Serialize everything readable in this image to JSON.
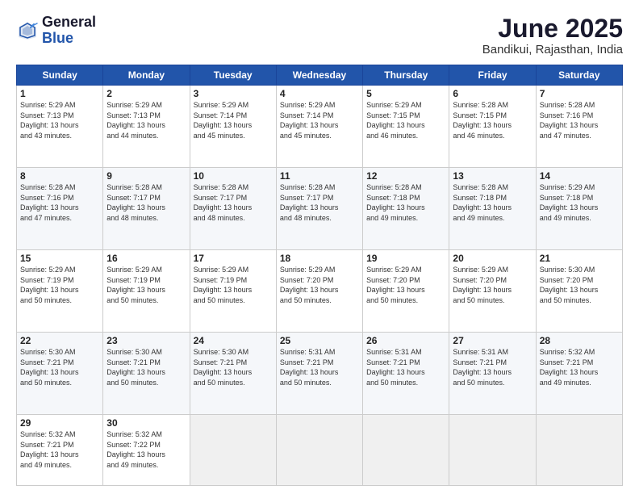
{
  "logo": {
    "general": "General",
    "blue": "Blue"
  },
  "title": "June 2025",
  "location": "Bandikui, Rajasthan, India",
  "headers": [
    "Sunday",
    "Monday",
    "Tuesday",
    "Wednesday",
    "Thursday",
    "Friday",
    "Saturday"
  ],
  "rows": [
    [
      {
        "day": "1",
        "text": "Sunrise: 5:29 AM\nSunset: 7:13 PM\nDaylight: 13 hours\nand 43 minutes."
      },
      {
        "day": "2",
        "text": "Sunrise: 5:29 AM\nSunset: 7:13 PM\nDaylight: 13 hours\nand 44 minutes."
      },
      {
        "day": "3",
        "text": "Sunrise: 5:29 AM\nSunset: 7:14 PM\nDaylight: 13 hours\nand 45 minutes."
      },
      {
        "day": "4",
        "text": "Sunrise: 5:29 AM\nSunset: 7:14 PM\nDaylight: 13 hours\nand 45 minutes."
      },
      {
        "day": "5",
        "text": "Sunrise: 5:29 AM\nSunset: 7:15 PM\nDaylight: 13 hours\nand 46 minutes."
      },
      {
        "day": "6",
        "text": "Sunrise: 5:28 AM\nSunset: 7:15 PM\nDaylight: 13 hours\nand 46 minutes."
      },
      {
        "day": "7",
        "text": "Sunrise: 5:28 AM\nSunset: 7:16 PM\nDaylight: 13 hours\nand 47 minutes."
      }
    ],
    [
      {
        "day": "8",
        "text": "Sunrise: 5:28 AM\nSunset: 7:16 PM\nDaylight: 13 hours\nand 47 minutes."
      },
      {
        "day": "9",
        "text": "Sunrise: 5:28 AM\nSunset: 7:17 PM\nDaylight: 13 hours\nand 48 minutes."
      },
      {
        "day": "10",
        "text": "Sunrise: 5:28 AM\nSunset: 7:17 PM\nDaylight: 13 hours\nand 48 minutes."
      },
      {
        "day": "11",
        "text": "Sunrise: 5:28 AM\nSunset: 7:17 PM\nDaylight: 13 hours\nand 48 minutes."
      },
      {
        "day": "12",
        "text": "Sunrise: 5:28 AM\nSunset: 7:18 PM\nDaylight: 13 hours\nand 49 minutes."
      },
      {
        "day": "13",
        "text": "Sunrise: 5:28 AM\nSunset: 7:18 PM\nDaylight: 13 hours\nand 49 minutes."
      },
      {
        "day": "14",
        "text": "Sunrise: 5:29 AM\nSunset: 7:18 PM\nDaylight: 13 hours\nand 49 minutes."
      }
    ],
    [
      {
        "day": "15",
        "text": "Sunrise: 5:29 AM\nSunset: 7:19 PM\nDaylight: 13 hours\nand 50 minutes."
      },
      {
        "day": "16",
        "text": "Sunrise: 5:29 AM\nSunset: 7:19 PM\nDaylight: 13 hours\nand 50 minutes."
      },
      {
        "day": "17",
        "text": "Sunrise: 5:29 AM\nSunset: 7:19 PM\nDaylight: 13 hours\nand 50 minutes."
      },
      {
        "day": "18",
        "text": "Sunrise: 5:29 AM\nSunset: 7:20 PM\nDaylight: 13 hours\nand 50 minutes."
      },
      {
        "day": "19",
        "text": "Sunrise: 5:29 AM\nSunset: 7:20 PM\nDaylight: 13 hours\nand 50 minutes."
      },
      {
        "day": "20",
        "text": "Sunrise: 5:29 AM\nSunset: 7:20 PM\nDaylight: 13 hours\nand 50 minutes."
      },
      {
        "day": "21",
        "text": "Sunrise: 5:30 AM\nSunset: 7:20 PM\nDaylight: 13 hours\nand 50 minutes."
      }
    ],
    [
      {
        "day": "22",
        "text": "Sunrise: 5:30 AM\nSunset: 7:21 PM\nDaylight: 13 hours\nand 50 minutes."
      },
      {
        "day": "23",
        "text": "Sunrise: 5:30 AM\nSunset: 7:21 PM\nDaylight: 13 hours\nand 50 minutes."
      },
      {
        "day": "24",
        "text": "Sunrise: 5:30 AM\nSunset: 7:21 PM\nDaylight: 13 hours\nand 50 minutes."
      },
      {
        "day": "25",
        "text": "Sunrise: 5:31 AM\nSunset: 7:21 PM\nDaylight: 13 hours\nand 50 minutes."
      },
      {
        "day": "26",
        "text": "Sunrise: 5:31 AM\nSunset: 7:21 PM\nDaylight: 13 hours\nand 50 minutes."
      },
      {
        "day": "27",
        "text": "Sunrise: 5:31 AM\nSunset: 7:21 PM\nDaylight: 13 hours\nand 50 minutes."
      },
      {
        "day": "28",
        "text": "Sunrise: 5:32 AM\nSunset: 7:21 PM\nDaylight: 13 hours\nand 49 minutes."
      }
    ],
    [
      {
        "day": "29",
        "text": "Sunrise: 5:32 AM\nSunset: 7:21 PM\nDaylight: 13 hours\nand 49 minutes."
      },
      {
        "day": "30",
        "text": "Sunrise: 5:32 AM\nSunset: 7:22 PM\nDaylight: 13 hours\nand 49 minutes."
      },
      {
        "day": "",
        "text": ""
      },
      {
        "day": "",
        "text": ""
      },
      {
        "day": "",
        "text": ""
      },
      {
        "day": "",
        "text": ""
      },
      {
        "day": "",
        "text": ""
      }
    ]
  ]
}
